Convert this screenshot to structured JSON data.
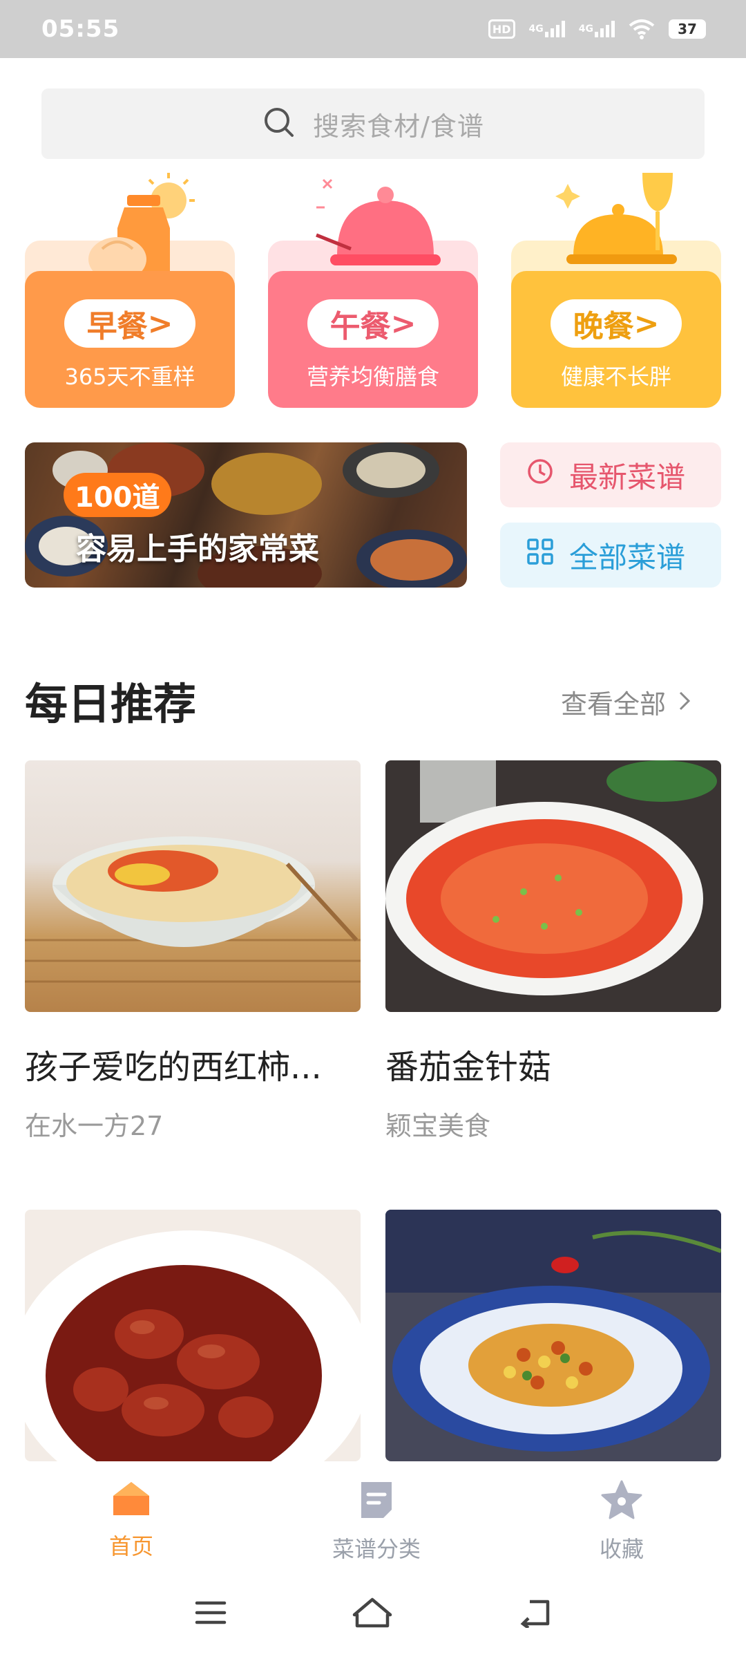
{
  "status_bar": {
    "time": "05:55",
    "hd": "HD",
    "signal1": "4G",
    "signal2": "4G",
    "battery": "37"
  },
  "search": {
    "placeholder": "搜索食材/食谱"
  },
  "meals": [
    {
      "label": "早餐",
      "arrow": ">",
      "subtitle": "365天不重样",
      "color": "#ff9a4a",
      "back": "#ffe9d6",
      "text_color": "#f07d2a"
    },
    {
      "label": "午餐",
      "arrow": ">",
      "subtitle": "营养均衡膳食",
      "color": "#ff7b8a",
      "back": "#ffe1e4",
      "text_color": "#ec5b6e"
    },
    {
      "label": "晚餐",
      "arrow": ">",
      "subtitle": "健康不长胖",
      "color": "#ffc23d",
      "back": "#fff0c9",
      "text_color": "#ee9f10"
    }
  ],
  "banner": {
    "badge": "100道",
    "text": "容易上手的家常菜"
  },
  "quick_links": {
    "latest": {
      "label": "最新菜谱",
      "color": "#e6566d",
      "bg": "#fdeced"
    },
    "all": {
      "label": "全部菜谱",
      "color": "#2a9ed8",
      "bg": "#e8f6fc"
    }
  },
  "daily": {
    "title": "每日推荐",
    "more": "查看全部",
    "recipes": [
      {
        "title": "孩子爱吃的西红柿...",
        "author": "在水一方27"
      },
      {
        "title": "番茄金针菇",
        "author": "颖宝美食"
      },
      {
        "title": "",
        "author": ""
      },
      {
        "title": "",
        "author": ""
      }
    ]
  },
  "nav": {
    "items": [
      {
        "label": "首页",
        "icon": "home-icon",
        "active": true
      },
      {
        "label": "菜谱分类",
        "icon": "recipe-category-icon",
        "active": false
      },
      {
        "label": "收藏",
        "icon": "star-icon",
        "active": false
      }
    ],
    "active_color": "#f7962f",
    "inactive_color": "#9aa0aa"
  }
}
